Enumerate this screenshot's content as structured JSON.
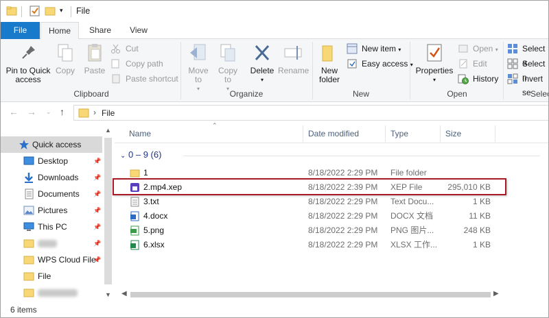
{
  "window": {
    "title": "File"
  },
  "tabs": [
    "File",
    "Home",
    "Share",
    "View"
  ],
  "ribbon": {
    "clipboard": {
      "label": "Clipboard",
      "pin": "Pin to Quick access",
      "copy": "Copy",
      "paste": "Paste",
      "cut": "Cut",
      "copy_path": "Copy path",
      "paste_shortcut": "Paste shortcut"
    },
    "organize": {
      "label": "Organize",
      "move_to": "Move to",
      "copy_to": "Copy to",
      "delete": "Delete",
      "rename": "Rename"
    },
    "new": {
      "label": "New",
      "new_folder": "New folder",
      "new_item": "New item",
      "easy_access": "Easy access"
    },
    "open": {
      "label": "Open",
      "properties": "Properties",
      "open": "Open",
      "edit": "Edit",
      "history": "History"
    },
    "select": {
      "label": "Selec",
      "select_all": "Select a",
      "select_none": "Select n",
      "invert": "Invert se"
    }
  },
  "address": {
    "crumb": "File"
  },
  "nav_pane": {
    "items": [
      {
        "label": "Quick access",
        "icon": "star-icon"
      },
      {
        "label": "Desktop",
        "icon": "desktop-icon"
      },
      {
        "label": "Downloads",
        "icon": "download-icon"
      },
      {
        "label": "Documents",
        "icon": "documents-icon"
      },
      {
        "label": "Pictures",
        "icon": "pictures-icon"
      },
      {
        "label": "This PC",
        "icon": "pc-icon"
      },
      {
        "label": "",
        "icon": "folder-icon"
      },
      {
        "label": "WPS Cloud File",
        "icon": "folder-icon"
      },
      {
        "label": "File",
        "icon": "folder-icon"
      },
      {
        "label": "",
        "icon": "folder-icon"
      }
    ]
  },
  "list": {
    "columns": [
      "Name",
      "Date modified",
      "Type",
      "Size"
    ],
    "group": "0 – 9 (6)",
    "files": [
      {
        "name": "1",
        "date": "8/18/2022 2:29 PM",
        "type": "File folder",
        "size": "",
        "icon": "folder-icon"
      },
      {
        "name": "2.mp4.xep",
        "date": "8/18/2022 2:39 PM",
        "type": "XEP File",
        "size": "295,010 KB",
        "icon": "xep-file-icon"
      },
      {
        "name": "3.txt",
        "date": "8/18/2022 2:29 PM",
        "type": "Text Docu...",
        "size": "1 KB",
        "icon": "text-file-icon"
      },
      {
        "name": "4.docx",
        "date": "8/18/2022 2:29 PM",
        "type": "DOCX 文档",
        "size": "11 KB",
        "icon": "docx-file-icon"
      },
      {
        "name": "5.png",
        "date": "8/18/2022 2:29 PM",
        "type": "PNG 图片...",
        "size": "248 KB",
        "icon": "png-file-icon"
      },
      {
        "name": "6.xlsx",
        "date": "8/18/2022 2:29 PM",
        "type": "XLSX 工作...",
        "size": "1 KB",
        "icon": "xlsx-file-icon"
      }
    ]
  },
  "status": {
    "count": "6 items"
  },
  "colors": {
    "accent": "#1979ca",
    "highlight_border": "#a91a26",
    "folder": "#f8d775"
  }
}
